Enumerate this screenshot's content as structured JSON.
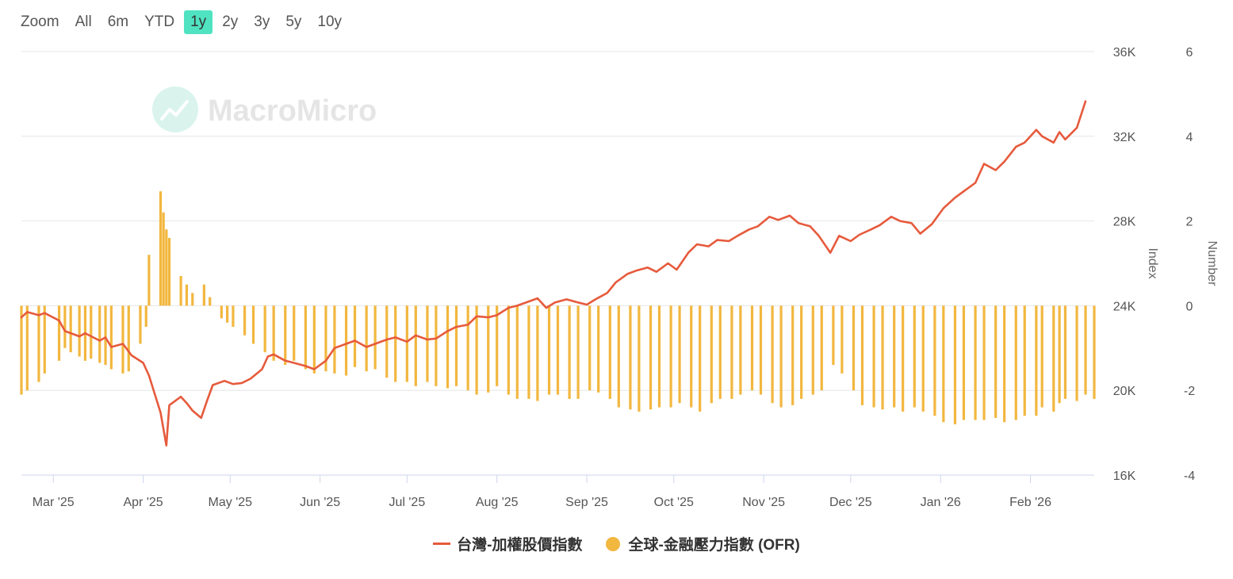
{
  "zoom": {
    "label": "Zoom",
    "options": [
      "All",
      "6m",
      "YTD",
      "1y",
      "2y",
      "3y",
      "5y",
      "10y"
    ],
    "active": "1y",
    "active_color": "#4fe3c1"
  },
  "watermark": {
    "text": "MacroMicro"
  },
  "legend": {
    "index_label": "台灣-加權股價指數",
    "ofr_label": "全球-金融壓力指數 (OFR)"
  },
  "colors": {
    "index_line": "#e65a3c",
    "ofr_bars": "#f2b73f",
    "grid": "#e6e6e6"
  },
  "chart_data": {
    "type": "line+bar",
    "x_range": [
      "2025-02-18",
      "2026-02-23"
    ],
    "x_tick_labels": [
      "Mar '25",
      "Apr '25",
      "May '25",
      "Jun '25",
      "Jul '25",
      "Aug '25",
      "Sep '25",
      "Oct '25",
      "Nov '25",
      "Dec '25",
      "Jan '26",
      "Feb '26"
    ],
    "y_left": {
      "title": "Index",
      "range": [
        16000,
        36000
      ],
      "tick_labels": [
        "16K",
        "20K",
        "24K",
        "28K",
        "32K",
        "36K"
      ]
    },
    "y_right": {
      "title": "Number",
      "range": [
        -4,
        6
      ],
      "tick_labels": [
        "-4",
        "-2",
        "0",
        "2",
        "4",
        "6"
      ]
    },
    "grid": true,
    "legend_position": "bottom-center",
    "series": [
      {
        "name": "台灣-加權股價指數",
        "kind": "line",
        "axis": "left",
        "points": [
          [
            "2025-02-18",
            23450
          ],
          [
            "2025-02-20",
            23700
          ],
          [
            "2025-02-24",
            23550
          ],
          [
            "2025-02-26",
            23650
          ],
          [
            "2025-03-03",
            23300
          ],
          [
            "2025-03-05",
            22800
          ],
          [
            "2025-03-10",
            22550
          ],
          [
            "2025-03-12",
            22700
          ],
          [
            "2025-03-17",
            22350
          ],
          [
            "2025-03-19",
            22500
          ],
          [
            "2025-03-21",
            22050
          ],
          [
            "2025-03-25",
            22200
          ],
          [
            "2025-03-28",
            21650
          ],
          [
            "2025-04-01",
            21300
          ],
          [
            "2025-04-03",
            20700
          ],
          [
            "2025-04-07",
            18950
          ],
          [
            "2025-04-09",
            17400
          ],
          [
            "2025-04-10",
            19300
          ],
          [
            "2025-04-14",
            19700
          ],
          [
            "2025-04-16",
            19400
          ],
          [
            "2025-04-18",
            19050
          ],
          [
            "2025-04-21",
            18700
          ],
          [
            "2025-04-23",
            19500
          ],
          [
            "2025-04-25",
            20250
          ],
          [
            "2025-04-29",
            20450
          ],
          [
            "2025-05-02",
            20300
          ],
          [
            "2025-05-05",
            20350
          ],
          [
            "2025-05-08",
            20550
          ],
          [
            "2025-05-12",
            21000
          ],
          [
            "2025-05-14",
            21600
          ],
          [
            "2025-05-16",
            21700
          ],
          [
            "2025-05-20",
            21400
          ],
          [
            "2025-05-23",
            21300
          ],
          [
            "2025-05-27",
            21150
          ],
          [
            "2025-05-30",
            21000
          ],
          [
            "2025-06-03",
            21400
          ],
          [
            "2025-06-06",
            22000
          ],
          [
            "2025-06-10",
            22200
          ],
          [
            "2025-06-13",
            22350
          ],
          [
            "2025-06-17",
            22050
          ],
          [
            "2025-06-20",
            22200
          ],
          [
            "2025-06-24",
            22400
          ],
          [
            "2025-06-27",
            22500
          ],
          [
            "2025-07-01",
            22300
          ],
          [
            "2025-07-04",
            22600
          ],
          [
            "2025-07-08",
            22400
          ],
          [
            "2025-07-11",
            22450
          ],
          [
            "2025-07-15",
            22800
          ],
          [
            "2025-07-18",
            23000
          ],
          [
            "2025-07-22",
            23100
          ],
          [
            "2025-07-25",
            23500
          ],
          [
            "2025-07-29",
            23450
          ],
          [
            "2025-08-01",
            23550
          ],
          [
            "2025-08-05",
            23900
          ],
          [
            "2025-08-08",
            24000
          ],
          [
            "2025-08-12",
            24200
          ],
          [
            "2025-08-15",
            24350
          ],
          [
            "2025-08-18",
            23900
          ],
          [
            "2025-08-21",
            24150
          ],
          [
            "2025-08-25",
            24300
          ],
          [
            "2025-08-29",
            24150
          ],
          [
            "2025-09-01",
            24050
          ],
          [
            "2025-09-04",
            24300
          ],
          [
            "2025-09-08",
            24600
          ],
          [
            "2025-09-11",
            25100
          ],
          [
            "2025-09-15",
            25500
          ],
          [
            "2025-09-18",
            25650
          ],
          [
            "2025-09-22",
            25800
          ],
          [
            "2025-09-25",
            25600
          ],
          [
            "2025-09-29",
            26000
          ],
          [
            "2025-10-02",
            25700
          ],
          [
            "2025-10-06",
            26500
          ],
          [
            "2025-10-09",
            26900
          ],
          [
            "2025-10-13",
            26800
          ],
          [
            "2025-10-16",
            27100
          ],
          [
            "2025-10-20",
            27050
          ],
          [
            "2025-10-23",
            27300
          ],
          [
            "2025-10-27",
            27600
          ],
          [
            "2025-10-30",
            27750
          ],
          [
            "2025-11-03",
            28200
          ],
          [
            "2025-11-06",
            28050
          ],
          [
            "2025-11-10",
            28250
          ],
          [
            "2025-11-13",
            27900
          ],
          [
            "2025-11-17",
            27750
          ],
          [
            "2025-11-20",
            27300
          ],
          [
            "2025-11-24",
            26500
          ],
          [
            "2025-11-27",
            27300
          ],
          [
            "2025-12-01",
            27050
          ],
          [
            "2025-12-04",
            27350
          ],
          [
            "2025-12-08",
            27600
          ],
          [
            "2025-12-11",
            27800
          ],
          [
            "2025-12-15",
            28200
          ],
          [
            "2025-12-18",
            28000
          ],
          [
            "2025-12-22",
            27900
          ],
          [
            "2025-12-25",
            27400
          ],
          [
            "2025-12-29",
            27850
          ],
          [
            "2026-01-02",
            28600
          ],
          [
            "2026-01-06",
            29100
          ],
          [
            "2026-01-09",
            29400
          ],
          [
            "2026-01-13",
            29800
          ],
          [
            "2026-01-16",
            30700
          ],
          [
            "2026-01-20",
            30400
          ],
          [
            "2026-01-23",
            30800
          ],
          [
            "2026-01-27",
            31500
          ],
          [
            "2026-01-30",
            31700
          ],
          [
            "2026-02-03",
            32300
          ],
          [
            "2026-02-05",
            32000
          ],
          [
            "2026-02-09",
            31700
          ],
          [
            "2026-02-11",
            32200
          ],
          [
            "2026-02-13",
            31850
          ],
          [
            "2026-02-17",
            32400
          ],
          [
            "2026-02-20",
            33650
          ]
        ]
      },
      {
        "name": "全球-金融壓力指數 (OFR)",
        "kind": "column",
        "axis": "right",
        "points": [
          [
            "2025-02-18",
            -2.1
          ],
          [
            "2025-02-20",
            -2.0
          ],
          [
            "2025-02-24",
            -1.8
          ],
          [
            "2025-02-26",
            -1.6
          ],
          [
            "2025-03-03",
            -1.3
          ],
          [
            "2025-03-05",
            -1.0
          ],
          [
            "2025-03-07",
            -1.1
          ],
          [
            "2025-03-10",
            -1.2
          ],
          [
            "2025-03-12",
            -1.3
          ],
          [
            "2025-03-14",
            -1.25
          ],
          [
            "2025-03-17",
            -1.35
          ],
          [
            "2025-03-19",
            -1.4
          ],
          [
            "2025-03-21",
            -1.5
          ],
          [
            "2025-03-25",
            -1.6
          ],
          [
            "2025-03-27",
            -1.55
          ],
          [
            "2025-03-31",
            -0.9
          ],
          [
            "2025-04-02",
            -0.5
          ],
          [
            "2025-04-03",
            1.2
          ],
          [
            "2025-04-07",
            2.7
          ],
          [
            "2025-04-08",
            2.2
          ],
          [
            "2025-04-09",
            1.8
          ],
          [
            "2025-04-10",
            1.6
          ],
          [
            "2025-04-14",
            0.7
          ],
          [
            "2025-04-16",
            0.5
          ],
          [
            "2025-04-18",
            0.3
          ],
          [
            "2025-04-22",
            0.5
          ],
          [
            "2025-04-24",
            0.2
          ],
          [
            "2025-04-28",
            -0.3
          ],
          [
            "2025-04-30",
            -0.4
          ],
          [
            "2025-05-02",
            -0.5
          ],
          [
            "2025-05-06",
            -0.7
          ],
          [
            "2025-05-09",
            -0.9
          ],
          [
            "2025-05-13",
            -1.1
          ],
          [
            "2025-05-16",
            -1.3
          ],
          [
            "2025-05-20",
            -1.4
          ],
          [
            "2025-05-23",
            -1.3
          ],
          [
            "2025-05-27",
            -1.5
          ],
          [
            "2025-05-30",
            -1.6
          ],
          [
            "2025-06-03",
            -1.55
          ],
          [
            "2025-06-06",
            -1.6
          ],
          [
            "2025-06-10",
            -1.65
          ],
          [
            "2025-06-13",
            -1.45
          ],
          [
            "2025-06-17",
            -1.55
          ],
          [
            "2025-06-20",
            -1.5
          ],
          [
            "2025-06-24",
            -1.7
          ],
          [
            "2025-06-27",
            -1.8
          ],
          [
            "2025-07-01",
            -1.8
          ],
          [
            "2025-07-04",
            -1.9
          ],
          [
            "2025-07-08",
            -1.8
          ],
          [
            "2025-07-11",
            -1.9
          ],
          [
            "2025-07-15",
            -1.95
          ],
          [
            "2025-07-18",
            -1.9
          ],
          [
            "2025-07-22",
            -2.0
          ],
          [
            "2025-07-25",
            -2.1
          ],
          [
            "2025-07-29",
            -2.05
          ],
          [
            "2025-08-01",
            -1.9
          ],
          [
            "2025-08-05",
            -2.1
          ],
          [
            "2025-08-08",
            -2.2
          ],
          [
            "2025-08-12",
            -2.2
          ],
          [
            "2025-08-15",
            -2.25
          ],
          [
            "2025-08-19",
            -2.1
          ],
          [
            "2025-08-22",
            -2.1
          ],
          [
            "2025-08-26",
            -2.2
          ],
          [
            "2025-08-29",
            -2.2
          ],
          [
            "2025-09-02",
            -2.0
          ],
          [
            "2025-09-05",
            -2.05
          ],
          [
            "2025-09-09",
            -2.2
          ],
          [
            "2025-09-12",
            -2.4
          ],
          [
            "2025-09-16",
            -2.45
          ],
          [
            "2025-09-19",
            -2.5
          ],
          [
            "2025-09-23",
            -2.45
          ],
          [
            "2025-09-26",
            -2.4
          ],
          [
            "2025-09-30",
            -2.4
          ],
          [
            "2025-10-03",
            -2.3
          ],
          [
            "2025-10-07",
            -2.4
          ],
          [
            "2025-10-10",
            -2.5
          ],
          [
            "2025-10-14",
            -2.3
          ],
          [
            "2025-10-17",
            -2.2
          ],
          [
            "2025-10-21",
            -2.2
          ],
          [
            "2025-10-24",
            -2.1
          ],
          [
            "2025-10-28",
            -2.0
          ],
          [
            "2025-10-31",
            -2.1
          ],
          [
            "2025-11-04",
            -2.3
          ],
          [
            "2025-11-07",
            -2.4
          ],
          [
            "2025-11-11",
            -2.35
          ],
          [
            "2025-11-14",
            -2.2
          ],
          [
            "2025-11-18",
            -2.1
          ],
          [
            "2025-11-21",
            -2.0
          ],
          [
            "2025-11-25",
            -1.4
          ],
          [
            "2025-11-28",
            -1.6
          ],
          [
            "2025-12-02",
            -2.0
          ],
          [
            "2025-12-05",
            -2.35
          ],
          [
            "2025-12-09",
            -2.4
          ],
          [
            "2025-12-12",
            -2.45
          ],
          [
            "2025-12-16",
            -2.4
          ],
          [
            "2025-12-19",
            -2.5
          ],
          [
            "2025-12-23",
            -2.4
          ],
          [
            "2025-12-26",
            -2.5
          ],
          [
            "2025-12-30",
            -2.6
          ],
          [
            "2026-01-02",
            -2.75
          ],
          [
            "2026-01-06",
            -2.8
          ],
          [
            "2026-01-09",
            -2.7
          ],
          [
            "2026-01-13",
            -2.7
          ],
          [
            "2026-01-16",
            -2.7
          ],
          [
            "2026-01-20",
            -2.65
          ],
          [
            "2026-01-23",
            -2.75
          ],
          [
            "2026-01-27",
            -2.7
          ],
          [
            "2026-01-30",
            -2.6
          ],
          [
            "2026-02-03",
            -2.6
          ],
          [
            "2026-02-05",
            -2.4
          ],
          [
            "2026-02-09",
            -2.5
          ],
          [
            "2026-02-11",
            -2.3
          ],
          [
            "2026-02-13",
            -2.2
          ],
          [
            "2026-02-17",
            -2.25
          ],
          [
            "2026-02-20",
            -2.1
          ],
          [
            "2026-02-23",
            -2.2
          ]
        ]
      }
    ]
  }
}
